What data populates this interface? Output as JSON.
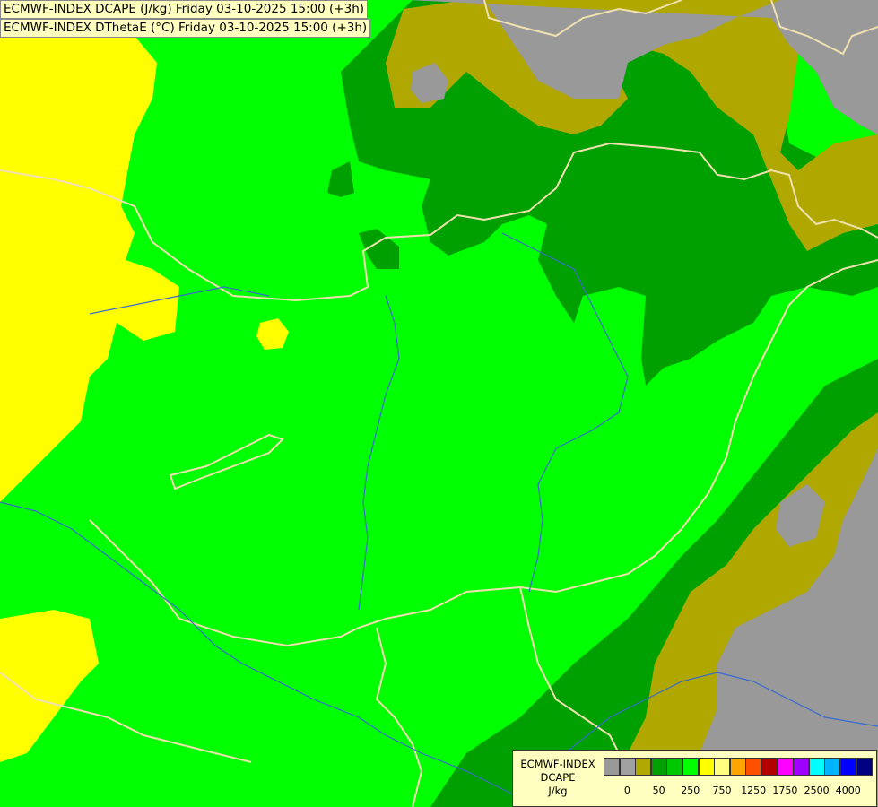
{
  "header": {
    "line1": "ECMWF-INDEX DCAPE (J/kg) Friday 03-10-2025 15:00 (+3h)",
    "line2": "ECMWF-INDEX DThetaE (°C) Friday 03-10-2025 15:00 (+3h)"
  },
  "legend": {
    "title_line1": "ECMWF-INDEX",
    "title_line2": "DCAPE",
    "title_line3": "J/kg",
    "swatch_colors": [
      "#999999",
      "#a0a0a0",
      "#b0a800",
      "#00a000",
      "#00c800",
      "#00ff00",
      "#ffff00",
      "#ffff80",
      "#ffa500",
      "#ff5000",
      "#b40000",
      "#ff00ff",
      "#a000ff",
      "#00ffff",
      "#00b4ff",
      "#0000ff",
      "#000080"
    ],
    "tick_labels": [
      "0",
      "50",
      "250",
      "750",
      "1250",
      "1750",
      "2500",
      "4000"
    ]
  },
  "map_colors": {
    "bright_green": "#00ff00",
    "dark_green": "#00a000",
    "olive": "#b0a800",
    "gray": "#999999",
    "yellow": "#ffff00",
    "borders": "#f0e0b0",
    "rivers": "#3a6ad0"
  }
}
